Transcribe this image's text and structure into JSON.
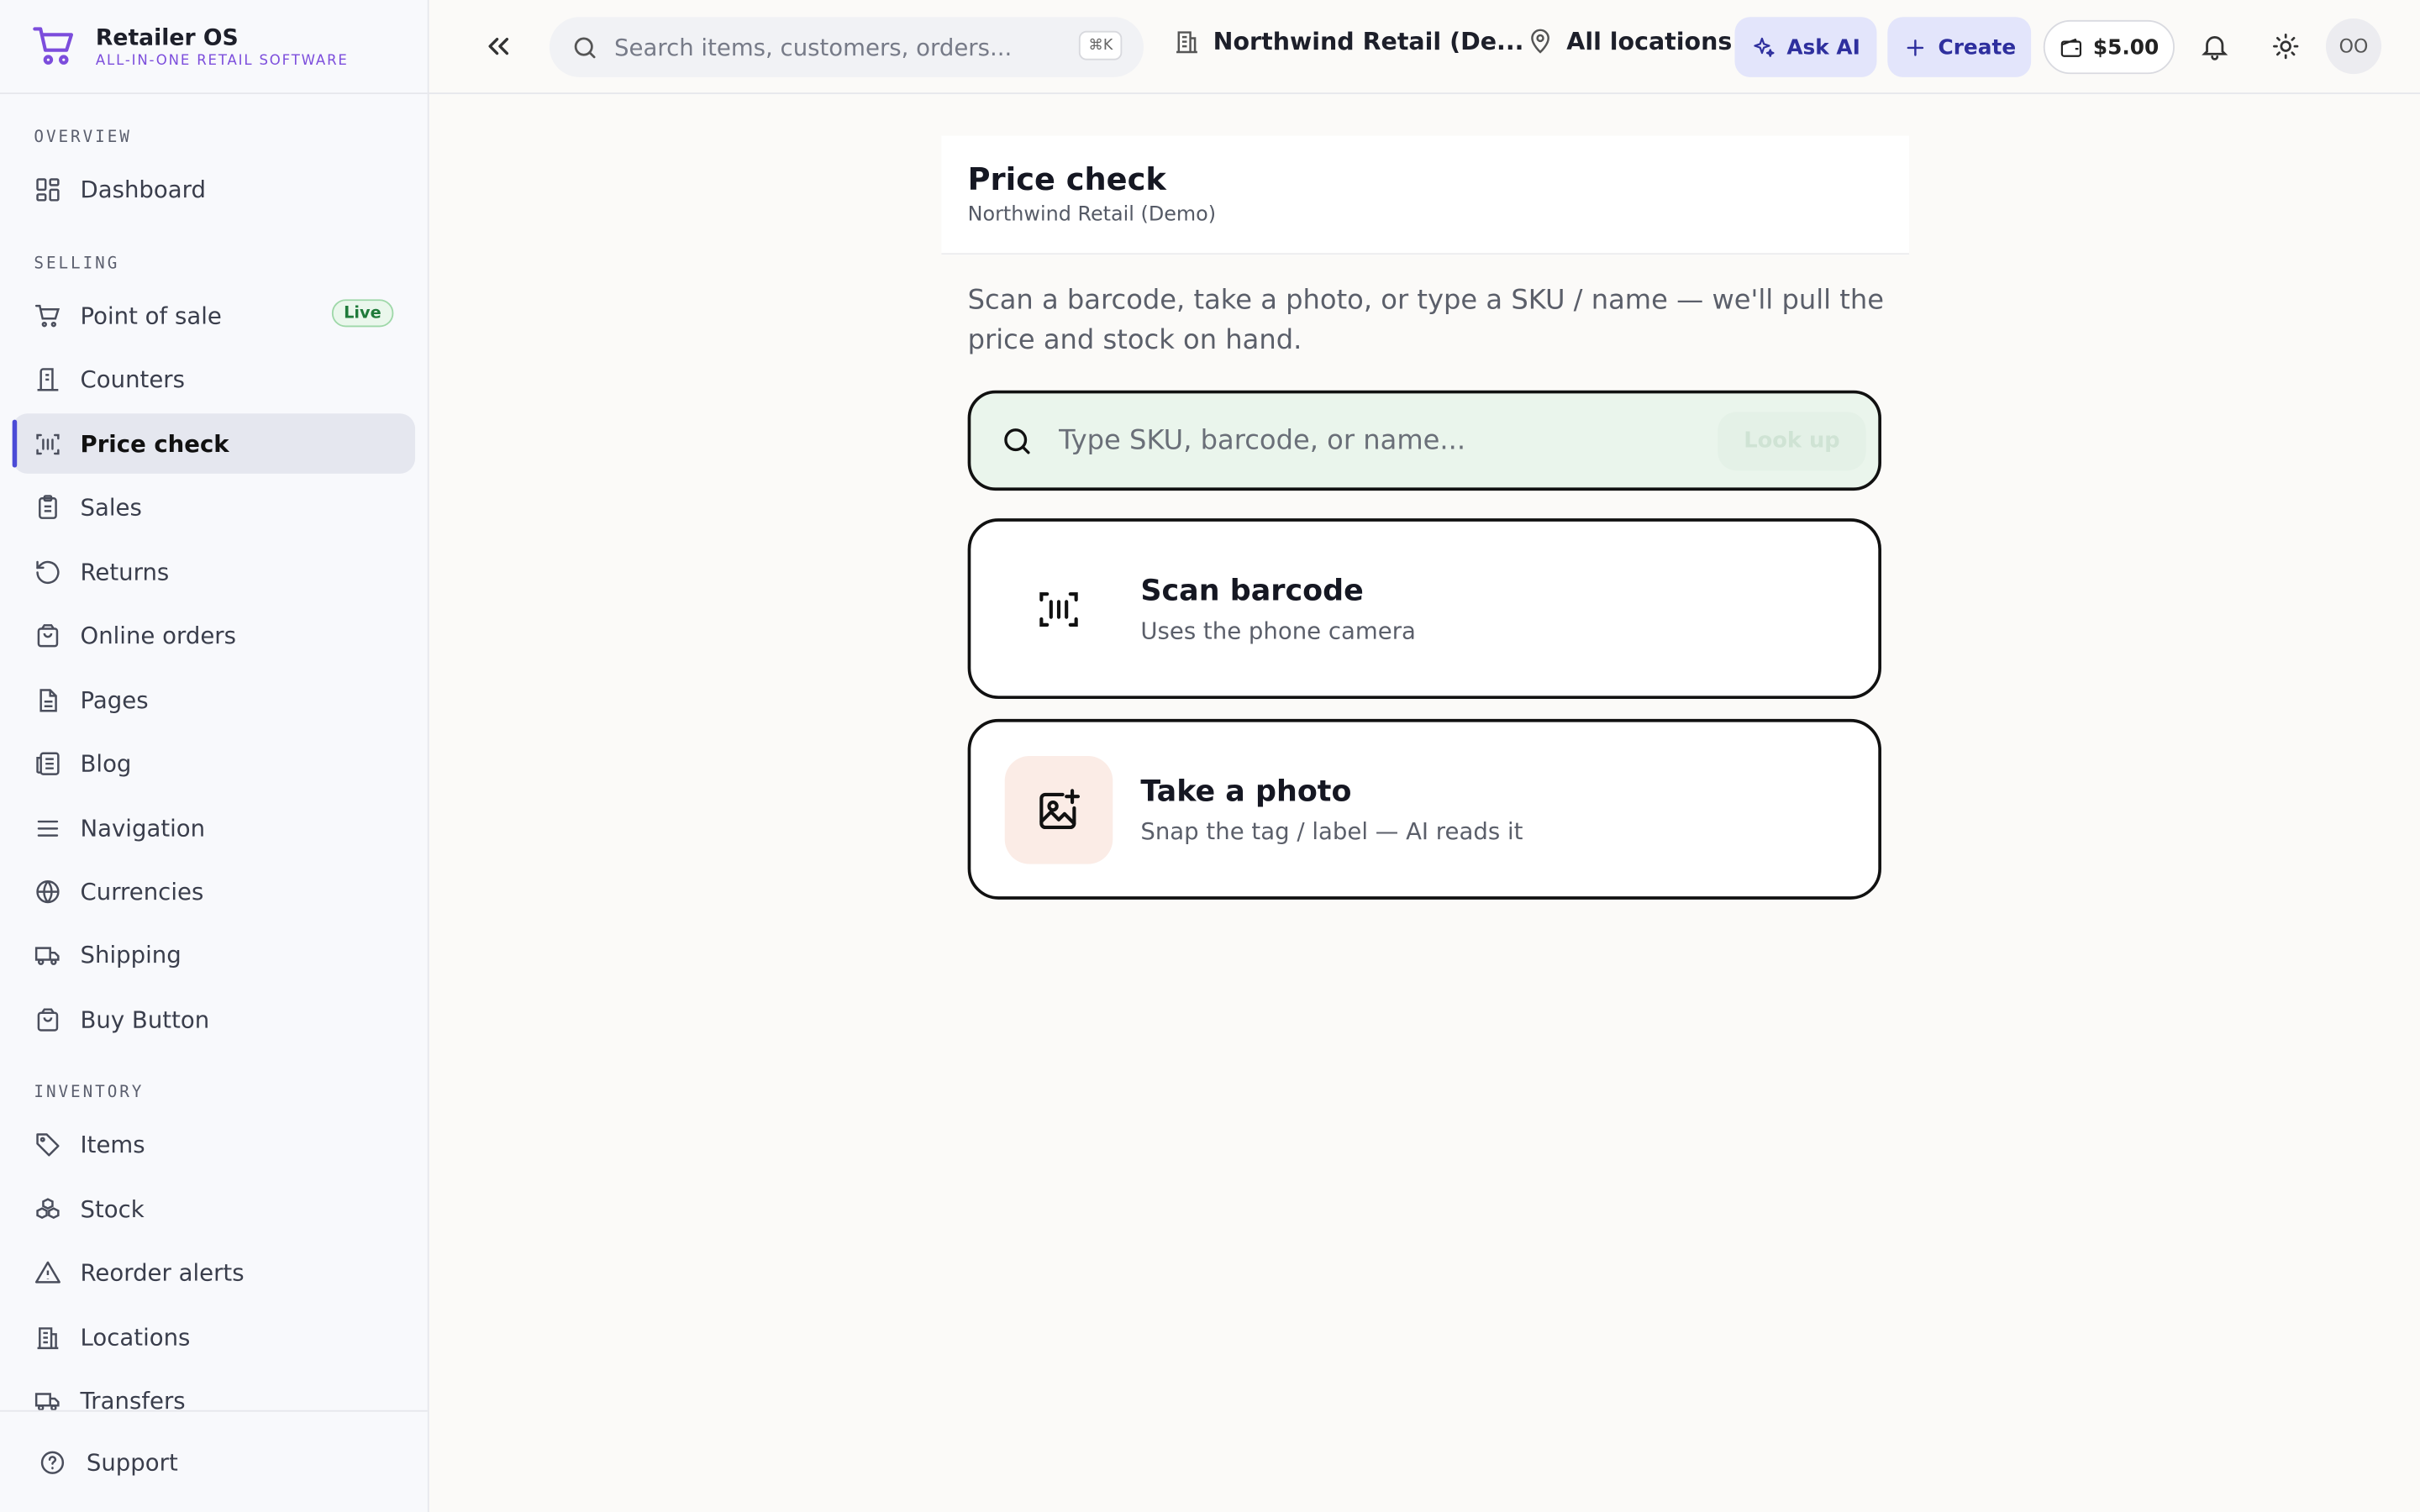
{
  "brand": {
    "name": "Retailer OS",
    "tagline": "ALL-IN-ONE RETAIL SOFTWARE"
  },
  "sidebar": {
    "sections": [
      {
        "label": "OVERVIEW"
      },
      {
        "label": "SELLING"
      },
      {
        "label": "INVENTORY"
      }
    ],
    "items": [
      {
        "label": "Dashboard",
        "icon": "dashboard-icon"
      },
      {
        "label": "Point of sale",
        "icon": "cart-icon",
        "badge": "Live"
      },
      {
        "label": "Counters",
        "icon": "counter-icon"
      },
      {
        "label": "Price check",
        "icon": "barcode-icon",
        "active": true
      },
      {
        "label": "Sales",
        "icon": "clipboard-icon"
      },
      {
        "label": "Returns",
        "icon": "rotate-icon"
      },
      {
        "label": "Online orders",
        "icon": "bag-icon"
      },
      {
        "label": "Pages",
        "icon": "file-icon"
      },
      {
        "label": "Blog",
        "icon": "newspaper-icon"
      },
      {
        "label": "Navigation",
        "icon": "menu-icon"
      },
      {
        "label": "Currencies",
        "icon": "globe-icon"
      },
      {
        "label": "Shipping",
        "icon": "truck-icon"
      },
      {
        "label": "Buy Button",
        "icon": "bag-icon"
      },
      {
        "label": "Items",
        "icon": "tag-icon"
      },
      {
        "label": "Stock",
        "icon": "boxes-icon"
      },
      {
        "label": "Reorder alerts",
        "icon": "alert-icon"
      },
      {
        "label": "Locations",
        "icon": "building-icon"
      },
      {
        "label": "Transfers",
        "icon": "truck-icon"
      }
    ],
    "support_label": "Support"
  },
  "topbar": {
    "search_placeholder": "Search items, customers, orders...",
    "search_shortcut": "⌘K",
    "store_name": "Northwind Retail (De...",
    "location": "All locations",
    "ask_ai": "Ask AI",
    "create": "Create",
    "balance": "$5.00",
    "avatar_initials": "OO"
  },
  "main": {
    "title": "Price check",
    "subtitle": "Northwind Retail (Demo)",
    "description": "Scan a barcode, take a photo, or type a SKU / name — we'll pull the price and stock on hand.",
    "lookup_placeholder": "Type SKU, barcode, or name...",
    "lookup_button": "Look up",
    "scan_card": {
      "title": "Scan barcode",
      "subtitle": "Uses the phone camera"
    },
    "photo_card": {
      "title": "Take a photo",
      "subtitle": "Snap the tag / label — AI reads it"
    }
  },
  "colors": {
    "accent": "#4b4bd6",
    "brand_tag": "#7c4ddc",
    "ai_button_bg": "#e3e5fb",
    "lookup_bg": "#eaf5ec",
    "photo_icon_bg": "#fbece6",
    "live_badge": "#1f7a3a"
  }
}
